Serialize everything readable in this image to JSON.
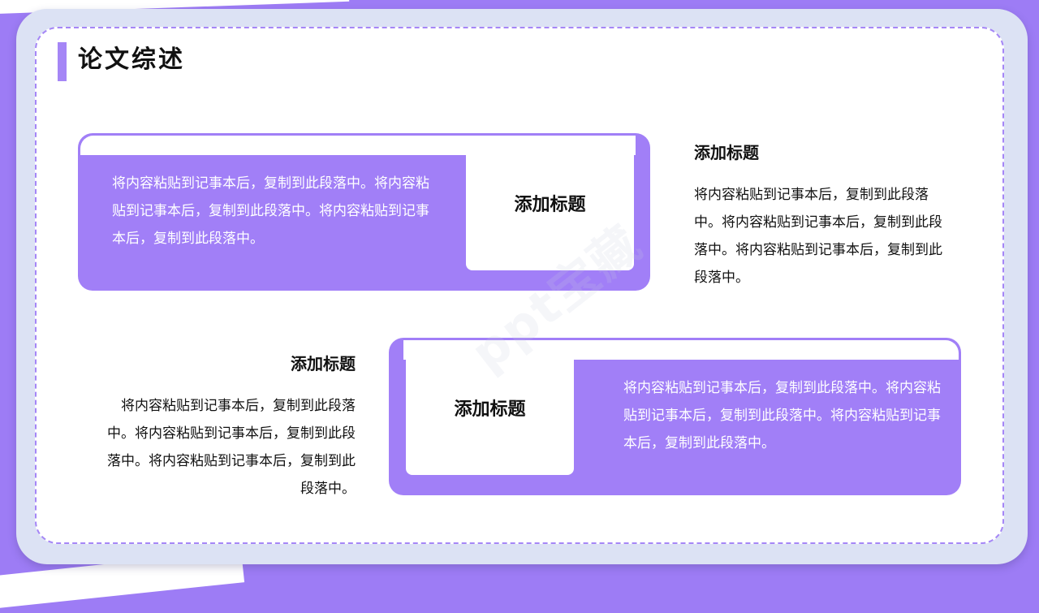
{
  "page": {
    "title": "论文综述"
  },
  "watermark": "ppt宝藏",
  "cards": [
    {
      "heading": "添加标题",
      "body": "将内容粘贴到记事本后，复制到此段落中。将内容粘贴到记事本后，复制到此段落中。将内容粘贴到记事本后，复制到此段落中。"
    },
    {
      "heading": "添加标题",
      "body": "将内容粘贴到记事本后，复制到此段落中。将内容粘贴到记事本后，复制到此段落中。将内容粘贴到记事本后，复制到此段落中。"
    }
  ],
  "side_blocks": [
    {
      "heading": "添加标题",
      "body": "将内容粘贴到记事本后，复制到此段落中。将内容粘贴到记事本后，复制到此段落中。将内容粘贴到记事本后，复制到此段落中。"
    },
    {
      "heading": "添加标题",
      "body": "将内容粘贴到记事本后，复制到此段落中。将内容粘贴到记事本后，复制到此段落中。将内容粘贴到记事本后，复制到此段落中。"
    }
  ],
  "colors": {
    "accent": "#a17ff7",
    "frame": "#dce2f4",
    "background": "#9d7cf5"
  }
}
